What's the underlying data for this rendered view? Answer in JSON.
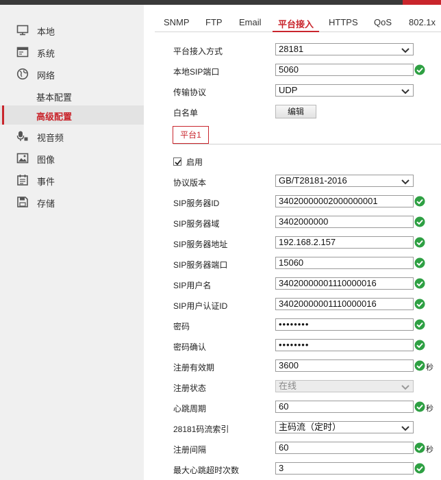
{
  "sidebar": {
    "items": [
      {
        "label": "本地",
        "icon": "monitor-icon"
      },
      {
        "label": "系统",
        "icon": "system-window-icon"
      },
      {
        "label": "网络",
        "icon": "globe-icon"
      },
      {
        "label": "视音频",
        "icon": "microphone-icon"
      },
      {
        "label": "图像",
        "icon": "image-icon"
      },
      {
        "label": "事件",
        "icon": "calendar-icon"
      },
      {
        "label": "存储",
        "icon": "floppy-disk-icon"
      }
    ],
    "network_sub": [
      {
        "label": "基本配置"
      },
      {
        "label": "高级配置",
        "active": true
      }
    ]
  },
  "tabs": [
    {
      "label": "SNMP"
    },
    {
      "label": "FTP"
    },
    {
      "label": "Email"
    },
    {
      "label": "平台接入",
      "active": true
    },
    {
      "label": "HTTPS"
    },
    {
      "label": "QoS"
    },
    {
      "label": "802.1x"
    }
  ],
  "form": {
    "access_mode": {
      "label": "平台接入方式",
      "value": "28181"
    },
    "local_sip_port": {
      "label": "本地SIP端口",
      "value": "5060"
    },
    "transport": {
      "label": "传输协议",
      "value": "UDP"
    },
    "whitelist": {
      "label": "白名单",
      "button": "编辑"
    }
  },
  "platform_tab": "平台1",
  "enable": {
    "label": "启用",
    "checked": true
  },
  "fields": {
    "protocol_version": {
      "label": "协议版本",
      "value": "GB/T28181-2016"
    },
    "sip_server_id": {
      "label": "SIP服务器ID",
      "value": "34020000002000000001"
    },
    "sip_server_domain": {
      "label": "SIP服务器域",
      "value": "3402000000"
    },
    "sip_server_address": {
      "label": "SIP服务器地址",
      "value": "192.168.2.157"
    },
    "sip_server_port": {
      "label": "SIP服务器端口",
      "value": "15060"
    },
    "sip_username": {
      "label": "SIP用户名",
      "value": "34020000001110000016"
    },
    "sip_auth_id": {
      "label": "SIP用户认证ID",
      "value": "34020000001110000016"
    },
    "password": {
      "label": "密码",
      "value": "••••••••"
    },
    "password_confirm": {
      "label": "密码确认",
      "value": "••••••••"
    },
    "register_validity": {
      "label": "注册有效期",
      "value": "3600",
      "unit": "秒"
    },
    "register_status": {
      "label": "注册状态",
      "value": "在线"
    },
    "heartbeat_period": {
      "label": "心跳周期",
      "value": "60",
      "unit": "秒"
    },
    "stream_index": {
      "label": "28181码流索引",
      "value": "主码流（定时）"
    },
    "register_interval": {
      "label": "注册间隔",
      "value": "60",
      "unit": "秒"
    },
    "max_heartbeat_timeout": {
      "label": "最大心跳超时次数",
      "value": "3"
    }
  },
  "colors": {
    "accent": "#c9252c",
    "valid": "#2ea043",
    "sidebar_bg": "#f0f0f0"
  }
}
